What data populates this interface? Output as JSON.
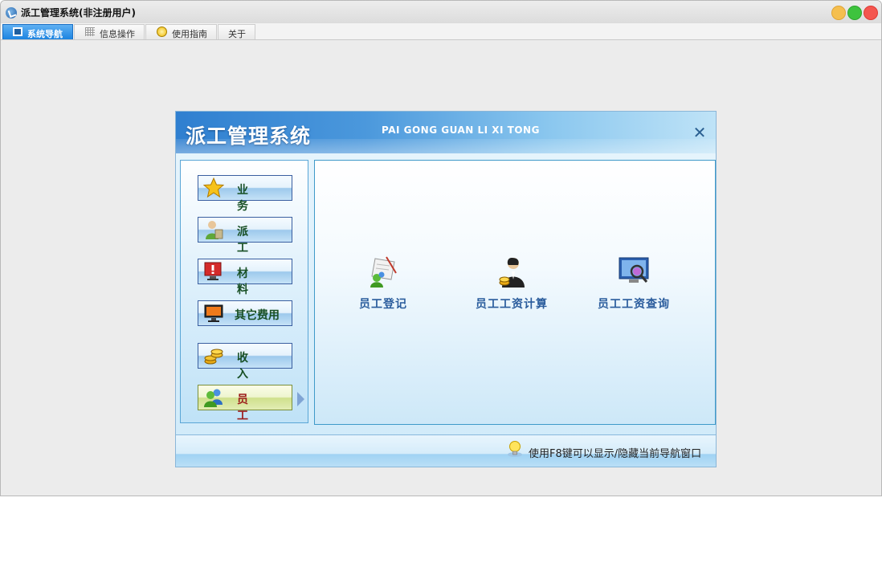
{
  "window": {
    "title": "派工管理系统(非注册用户)"
  },
  "tabs": [
    {
      "label": "系统导航",
      "icon": "monitor-icon",
      "active": true
    },
    {
      "label": "信息操作",
      "icon": "grid-icon",
      "active": false
    },
    {
      "label": "使用指南",
      "icon": "bulb-icon",
      "active": false
    },
    {
      "label": "关于",
      "icon": "",
      "active": false
    }
  ],
  "dialog": {
    "title": "派工管理系统",
    "subtitle": "PAI GONG GUAN LI XI TONG",
    "close": "✕"
  },
  "nav": {
    "items": [
      {
        "label": "业 务",
        "icon": "star-icon"
      },
      {
        "label": "派 工",
        "icon": "worker-icon"
      },
      {
        "label": "材 料",
        "icon": "alert-monitor-icon"
      },
      {
        "label": "其它费用",
        "icon": "monitor-icon"
      },
      {
        "label": "收 入",
        "icon": "coins-icon"
      },
      {
        "label": "员 工",
        "icon": "users-icon",
        "active": true
      }
    ]
  },
  "functions": [
    {
      "label": "员工登记",
      "icon": "user-register-icon"
    },
    {
      "label": "员工工资计算",
      "icon": "salary-calc-icon"
    },
    {
      "label": "员工工资查询",
      "icon": "salary-query-icon"
    }
  ],
  "footer": {
    "hint": "使用F8键可以显示/隐藏当前导航窗口"
  },
  "colors": {
    "accent": "#1c83e0",
    "header_start": "#2f7fd0",
    "active_nav": "#cfe08c",
    "label": "#2a5c9c"
  }
}
